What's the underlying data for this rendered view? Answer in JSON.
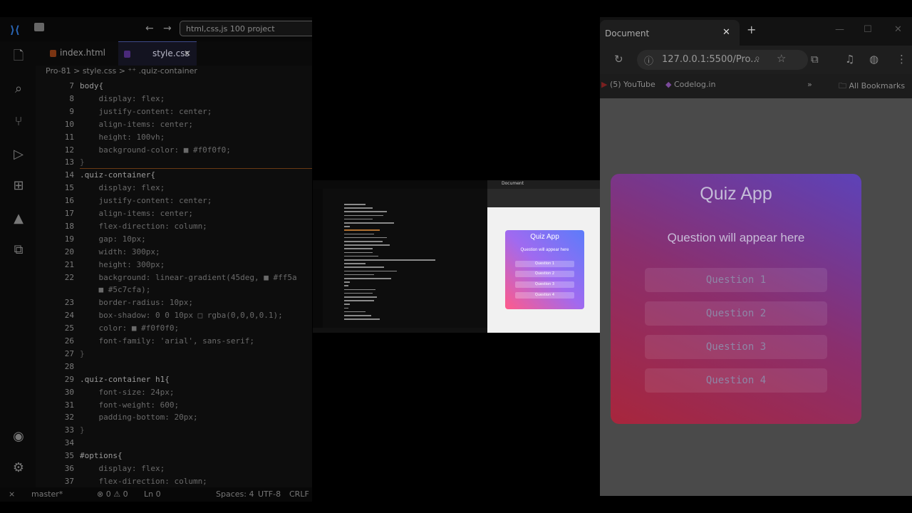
{
  "colors": {
    "editor_bg": "#0d0d0d",
    "keyword": "#c8c8c8",
    "line_number": "#7a7a7a",
    "gradient": [
      "#ff5a8a",
      "#a06af0",
      "#5c7cfa"
    ]
  },
  "vscode": {
    "search_text": "html,css,js 100 project",
    "tabs": [
      {
        "label": "index.html",
        "active": false
      },
      {
        "label": "style.css",
        "active": true
      }
    ],
    "tab_close": "✕",
    "breadcrumb": "Pro-81 > style.css > ⁺⁺ .quiz-container",
    "activity_icons": [
      "files-icon",
      "search-icon",
      "source-control-icon",
      "run-debug-icon",
      "extensions-icon",
      "azure-icon",
      "remote-explorer-icon",
      "account-icon",
      "settings-icon"
    ],
    "code_lines": [
      {
        "n": "7",
        "t": "body{"
      },
      {
        "n": "8",
        "t": "    display: flex;"
      },
      {
        "n": "9",
        "t": "    justify-content: center;"
      },
      {
        "n": "10",
        "t": "    align-items: center;"
      },
      {
        "n": "11",
        "t": "    height: 100vh;"
      },
      {
        "n": "12",
        "t": "    background-color: ■ #f0f0f0;"
      },
      {
        "n": "13",
        "t": "}"
      },
      {
        "n": "14",
        "t": ".quiz-container{"
      },
      {
        "n": "15",
        "t": "    display: flex;"
      },
      {
        "n": "16",
        "t": "    justify-content: center;"
      },
      {
        "n": "17",
        "t": "    align-items: center;"
      },
      {
        "n": "18",
        "t": "    flex-direction: column;"
      },
      {
        "n": "19",
        "t": "    gap: 10px;"
      },
      {
        "n": "20",
        "t": "    width: 300px;"
      },
      {
        "n": "21",
        "t": "    height: 300px;"
      },
      {
        "n": "22",
        "t": "    background: linear-gradient(45deg, ■ #ff5a"
      },
      {
        "n": "",
        "t": "    ■ #5c7cfa);"
      },
      {
        "n": "23",
        "t": "    border-radius: 10px;"
      },
      {
        "n": "24",
        "t": "    box-shadow: 0 0 10px □ rgba(0,0,0,0.1);"
      },
      {
        "n": "25",
        "t": "    color: ■ #f0f0f0;"
      },
      {
        "n": "26",
        "t": "    font-family: 'arial', sans-serif;"
      },
      {
        "n": "27",
        "t": "}"
      },
      {
        "n": "28",
        "t": ""
      },
      {
        "n": "29",
        "t": ".quiz-container h1{"
      },
      {
        "n": "30",
        "t": "    font-size: 24px;"
      },
      {
        "n": "31",
        "t": "    font-weight: 600;"
      },
      {
        "n": "32",
        "t": "    padding-bottom: 20px;"
      },
      {
        "n": "33",
        "t": "}"
      },
      {
        "n": "34",
        "t": ""
      },
      {
        "n": "35",
        "t": "#options{"
      },
      {
        "n": "36",
        "t": "    display: flex;"
      },
      {
        "n": "37",
        "t": "    flex-direction: column;"
      }
    ],
    "status": {
      "branch": "master*",
      "errors": "⊗ 0 ⚠ 0",
      "position": "Ln 0",
      "spaces": "Spaces: 4",
      "encoding": "UTF-8",
      "eol": "CRLF"
    }
  },
  "mini": {
    "tab_title": "Document",
    "card_title": "Quiz App",
    "card_question": "Question will appear here",
    "options": [
      "Question 1",
      "Question 2",
      "Question 3",
      "Question 4"
    ]
  },
  "browser": {
    "tab_title": "Document",
    "tab_close": "✕",
    "new_tab": "+",
    "url": "127.0.0.1:5500/Pro...",
    "bookmarks": [
      "(5) YouTube",
      "Codelog.in",
      "All Bookmarks"
    ],
    "quiz": {
      "title": "Quiz App",
      "question": "Question will appear here",
      "options": [
        "Question 1",
        "Question 2",
        "Question 3",
        "Question 4"
      ]
    }
  }
}
